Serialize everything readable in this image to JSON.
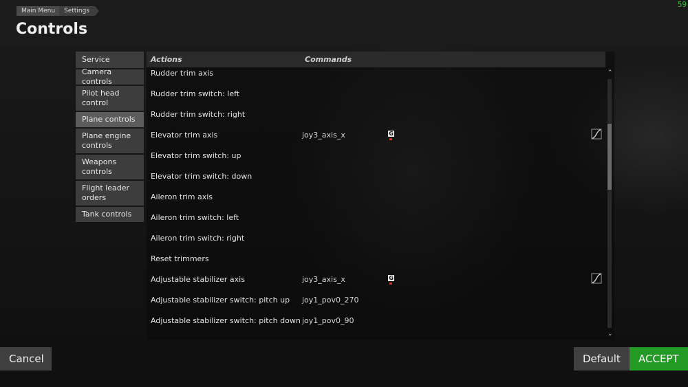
{
  "header": {
    "breadcrumb": [
      "Main Menu",
      "Settings"
    ],
    "title": "Controls",
    "fps": "59"
  },
  "sidebar": {
    "items": [
      {
        "label": "Service"
      },
      {
        "label": "Camera controls"
      },
      {
        "label": "Pilot head control"
      },
      {
        "label": "Plane controls"
      },
      {
        "label": "Plane engine controls"
      },
      {
        "label": "Weapons controls"
      },
      {
        "label": "Flight leader orders"
      },
      {
        "label": "Tank controls"
      }
    ],
    "active_index": 3
  },
  "table": {
    "columns": [
      "Actions",
      "Commands"
    ],
    "rows": [
      {
        "action": "Rudder trim axis",
        "command": ""
      },
      {
        "action": "Rudder trim switch: left",
        "command": ""
      },
      {
        "action": "Rudder trim switch: right",
        "command": ""
      },
      {
        "action": "Elevator trim axis",
        "command": "joy3_axis_x",
        "badge": "G",
        "curve": true
      },
      {
        "action": "Elevator trim switch: up",
        "command": ""
      },
      {
        "action": "Elevator trim switch: down",
        "command": ""
      },
      {
        "action": "Aileron trim axis",
        "command": ""
      },
      {
        "action": "Aileron trim switch: left",
        "command": ""
      },
      {
        "action": "Aileron trim switch: right",
        "command": ""
      },
      {
        "action": "Reset trimmers",
        "command": ""
      },
      {
        "action": "Adjustable stabilizer axis",
        "command": "joy3_axis_x",
        "badge": "G",
        "curve": true
      },
      {
        "action": "Adjustable stabilizer switch: pitch up",
        "command": "joy1_pov0_270"
      },
      {
        "action": "Adjustable stabilizer switch: pitch down",
        "command": "joy1_pov0_90"
      }
    ]
  },
  "buttons": {
    "cancel": "Cancel",
    "default": "Default",
    "accept": "ACCEPT"
  },
  "colors": {
    "accent_green": "#239a23",
    "fps_green": "#3bc43b"
  }
}
